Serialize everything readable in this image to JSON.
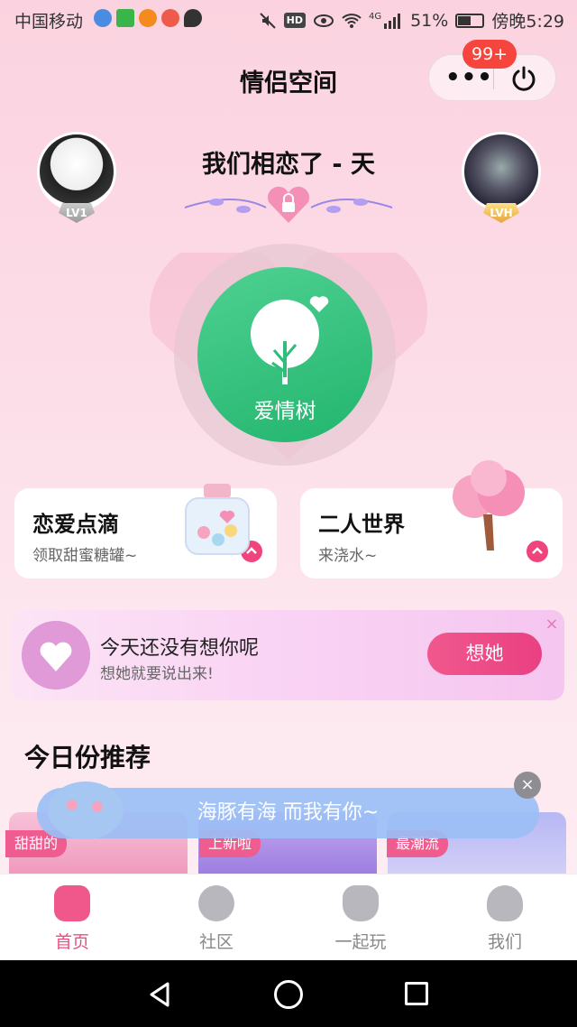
{
  "status_bar": {
    "carrier": "中国移动",
    "battery": "51%",
    "time": "傍晚5:29",
    "hd": "HD",
    "network": "4G"
  },
  "header": {
    "title": "情侣空间",
    "more_icon": "more-dots-icon",
    "power_icon": "power-icon",
    "notification_badge": "99+"
  },
  "couple": {
    "title": "我们相恋了 - 天",
    "left_level": "LV1",
    "right_level": "LVH"
  },
  "love_tree": {
    "label": "爱情树"
  },
  "cards": [
    {
      "title": "恋爱点滴",
      "subtitle": "领取甜蜜糖罐~"
    },
    {
      "title": "二人世界",
      "subtitle": "来浇水~"
    }
  ],
  "banner": {
    "title": "今天还没有想你呢",
    "subtitle": "想她就要说出来!",
    "button": "想她",
    "close": "×"
  },
  "recommend": {
    "section_title": "今日份推荐",
    "tags": [
      "甜甜的",
      "上新啦",
      "最潮流"
    ]
  },
  "toast": {
    "text": "海豚有海 而我有你~",
    "close": "×"
  },
  "tabbar": {
    "items": [
      {
        "label": "首页",
        "icon": "home-icon",
        "active": true
      },
      {
        "label": "社区",
        "icon": "feather-icon",
        "active": false
      },
      {
        "label": "一起玩",
        "icon": "gamepad-icon",
        "active": false
      },
      {
        "label": "我们",
        "icon": "couple-icon",
        "active": false
      }
    ]
  },
  "colors": {
    "accent": "#f0588c",
    "tree_green": "#22b56e",
    "badge_red": "#f5453d"
  }
}
